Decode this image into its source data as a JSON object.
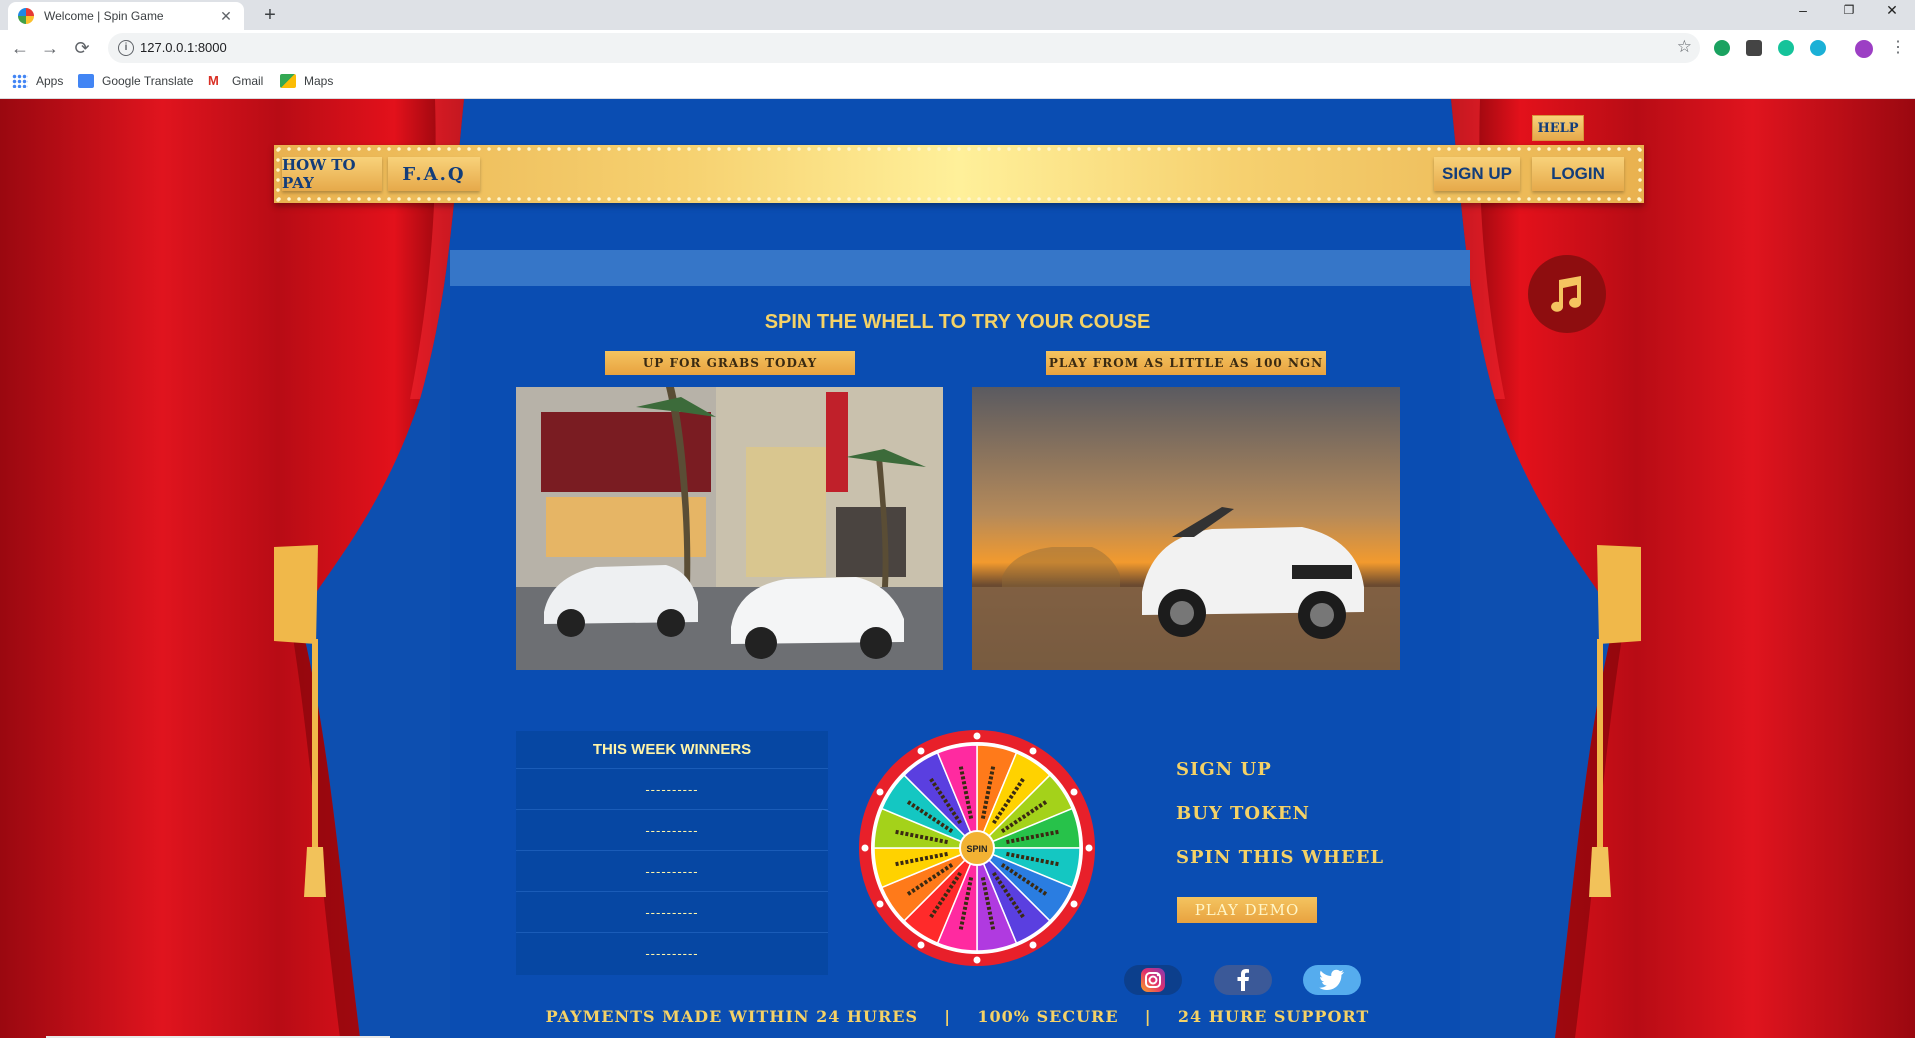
{
  "browser": {
    "tab_title": "Welcome | Spin Game",
    "tab_close": "✕",
    "new_tab": "+",
    "url": "127.0.0.1:8000",
    "window_controls": {
      "minimize": "–",
      "restore": "❐",
      "close": "✕"
    },
    "bookmarks": [
      "Apps",
      "Google Translate",
      "Gmail",
      "Maps"
    ]
  },
  "nav": {
    "how_to_pay": "HOW TO PAY",
    "faq": "F.A.Q",
    "sign_up": "SIGN UP",
    "login": "LOGIN",
    "help": "HELP"
  },
  "main": {
    "title": "SPIN THE WHELL TO TRY YOUR COUSE",
    "banner_left": "UP FOR GRABS TODAY",
    "banner_right": "PLAY FROM AS LITTLE AS 100 NGN"
  },
  "winners": {
    "title": "THIS WEEK WINNERS",
    "rows": [
      "----------",
      "----------",
      "----------",
      "----------",
      "----------"
    ]
  },
  "wheel": {
    "center_label": "SPIN"
  },
  "steps": {
    "items": [
      "SIGN UP",
      "BUY TOKEN",
      "SPIN THIS WHEEL"
    ],
    "demo_button": "PLAY DEMO"
  },
  "social": [
    "instagram-icon",
    "facebook-icon",
    "twitter-icon"
  ],
  "footer": {
    "payments": "PAYMENTS MADE WITHIN 24 HURES",
    "sep1": "|",
    "secure": "100% SECURE",
    "sep2": "|",
    "support": "24 HURE SUPPORT"
  },
  "colors": {
    "stage_blue": "#0a4db2",
    "curtain_red": "#c8101a",
    "gold": "#f5d266",
    "button_gold": "#e8a23f"
  }
}
